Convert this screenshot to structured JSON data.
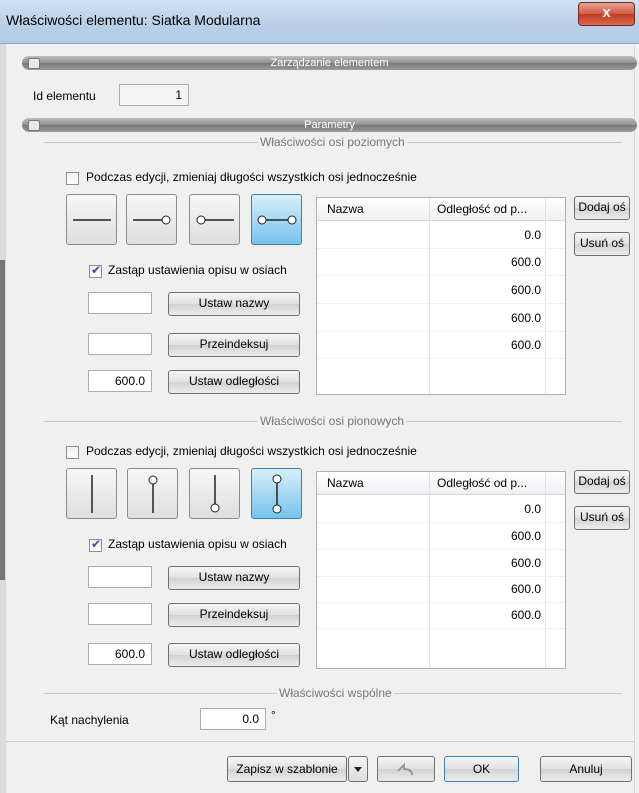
{
  "window": {
    "title": "Właściwości elementu: Siatka Modularna",
    "close": "x"
  },
  "sections": {
    "manage": "Zarządzanie elementem",
    "params": "Parametry"
  },
  "id_label": "Id elementu",
  "id_value": "1",
  "horizontal": {
    "group_title": "Właściwości osi poziomych",
    "edit_all_label": "Podczas edycji, zmieniaj długości wszystkich osi jednocześnie",
    "edit_all_checked": false,
    "replace_label": "Zastąp ustawienia opisu w osiach",
    "replace_checked": true,
    "names_value": "",
    "reindex_value": "",
    "distance_value": "600.0",
    "set_names": "Ustaw nazwy",
    "reindex": "Przeindeksuj",
    "set_distances": "Ustaw odległości",
    "columns": [
      "Nazwa",
      "Odległość od p..."
    ],
    "rows": [
      {
        "name": "",
        "dist": "0.0"
      },
      {
        "name": "",
        "dist": "600.0"
      },
      {
        "name": "",
        "dist": "600.0"
      },
      {
        "name": "",
        "dist": "600.0"
      },
      {
        "name": "",
        "dist": "600.0"
      }
    ],
    "add": "Dodaj oś",
    "remove": "Usuń oś",
    "axis_styles": [
      "line",
      "line-end-circle",
      "line-start-circle",
      "line-both-circles"
    ],
    "selected_style": 3
  },
  "vertical": {
    "group_title": "Właściwości osi pionowych",
    "edit_all_label": "Podczas edycji, zmieniaj długości wszystkich osi jednocześnie",
    "edit_all_checked": false,
    "replace_label": "Zastąp ustawienia opisu w osiach",
    "replace_checked": true,
    "names_value": "",
    "reindex_value": "",
    "distance_value": "600.0",
    "set_names": "Ustaw nazwy",
    "reindex": "Przeindeksuj",
    "set_distances": "Ustaw odległości",
    "columns": [
      "Nazwa",
      "Odległość od p..."
    ],
    "rows": [
      {
        "name": "",
        "dist": "0.0"
      },
      {
        "name": "",
        "dist": "600.0"
      },
      {
        "name": "",
        "dist": "600.0"
      },
      {
        "name": "",
        "dist": "600.0"
      },
      {
        "name": "",
        "dist": "600.0"
      }
    ],
    "add": "Dodaj oś",
    "remove": "Usuń oś",
    "axis_styles": [
      "line",
      "line-top-circle",
      "line-bottom-circle",
      "line-both-circles"
    ],
    "selected_style": 3
  },
  "common": {
    "group_title": "Właściwości wspólne",
    "angle_label": "Kąt nachylenia",
    "angle_value": "0.0",
    "angle_unit": "°"
  },
  "footer": {
    "save_template": "Zapisz w szablonie",
    "ok": "OK",
    "cancel": "Anuluj"
  },
  "colors": {
    "accent": "#76c3ec",
    "title_bar": "#b9cfe8",
    "close": "#c23a22"
  }
}
